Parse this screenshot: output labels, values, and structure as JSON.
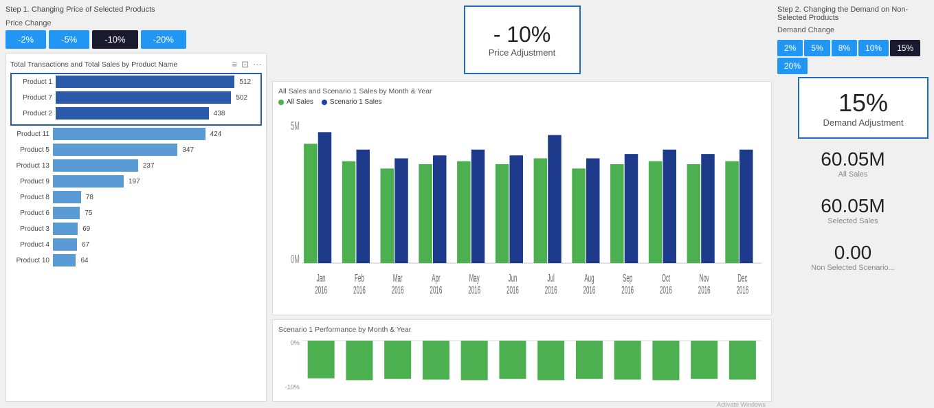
{
  "step1": {
    "label": "Step 1. Changing Price of Selected Products",
    "price_change_label": "Price Change",
    "price_buttons": [
      {
        "value": "-2%",
        "active": false
      },
      {
        "value": "-5%",
        "active": false
      },
      {
        "value": "-10%",
        "active": true
      },
      {
        "value": "-20%",
        "active": false
      }
    ],
    "price_adj": {
      "value": "- 10%",
      "label": "Price Adjustment"
    },
    "chart_title": "Total Transactions and Total Sales by Product Name",
    "products": [
      {
        "name": "Product 1",
        "value": 512,
        "pct": 100,
        "selected": true
      },
      {
        "name": "Product 7",
        "value": 502,
        "pct": 98,
        "selected": true
      },
      {
        "name": "Product 2",
        "value": 438,
        "pct": 85,
        "selected": true
      },
      {
        "name": "Product 11",
        "value": 424,
        "pct": 83,
        "selected": false
      },
      {
        "name": "Product 5",
        "value": 347,
        "pct": 68,
        "selected": false
      },
      {
        "name": "Product 13",
        "value": 237,
        "pct": 46,
        "selected": false
      },
      {
        "name": "Product 9",
        "value": 197,
        "pct": 38,
        "selected": false
      },
      {
        "name": "Product 8",
        "value": 78,
        "pct": 15,
        "selected": false
      },
      {
        "name": "Product 6",
        "value": 75,
        "pct": 15,
        "selected": false
      },
      {
        "name": "Product 3",
        "value": 69,
        "pct": 13,
        "selected": false
      },
      {
        "name": "Product 4",
        "value": 67,
        "pct": 13,
        "selected": false
      },
      {
        "name": "Product 10",
        "value": 64,
        "pct": 12,
        "selected": false
      }
    ]
  },
  "step2": {
    "label": "Step 2. Changing the Demand on Non-Selected Products",
    "demand_change_label": "Demand Change",
    "demand_buttons": [
      {
        "value": "2%",
        "active": false
      },
      {
        "value": "5%",
        "active": false
      },
      {
        "value": "8%",
        "active": false
      },
      {
        "value": "10%",
        "active": false
      },
      {
        "value": "15%",
        "active": true
      },
      {
        "value": "20%",
        "active": false
      }
    ],
    "demand_adj": {
      "value": "15%",
      "label": "Demand Adjustment"
    },
    "all_sales": {
      "value": "60.05M",
      "label": "All Sales"
    },
    "selected_sales": {
      "value": "60.05M",
      "label": "Selected Sales"
    },
    "non_selected": {
      "value": "0.00",
      "label": "Non Selected Scenario..."
    }
  },
  "line_chart": {
    "title": "All Sales and Scenario 1 Sales by Month & Year",
    "legend": [
      {
        "label": "All Sales",
        "color": "#4caf50"
      },
      {
        "label": "Scenario 1 Sales",
        "color": "#1e40af"
      }
    ],
    "y_label_top": "5M",
    "y_label_bottom": "0M",
    "months": [
      "Jan 2016",
      "Feb 2016",
      "Mar 2016",
      "Apr 2016",
      "May 2016",
      "Jun 2016",
      "Jul 2016",
      "Aug 2016",
      "Sep 2016",
      "Oct 2016",
      "Nov 2016",
      "Dec 2016"
    ],
    "green_bars": [
      82,
      70,
      65,
      68,
      70,
      68,
      72,
      65,
      68,
      70,
      68,
      70
    ],
    "blue_bars": [
      90,
      78,
      72,
      74,
      78,
      74,
      88,
      72,
      75,
      78,
      75,
      78
    ]
  },
  "scenario_chart": {
    "title": "Scenario 1 Performance by Month & Year",
    "y_label_top": "0%",
    "y_label_bottom": "-10%",
    "bars": [
      62,
      65,
      63,
      64,
      65,
      63,
      65,
      63,
      64,
      65,
      63,
      64
    ]
  }
}
